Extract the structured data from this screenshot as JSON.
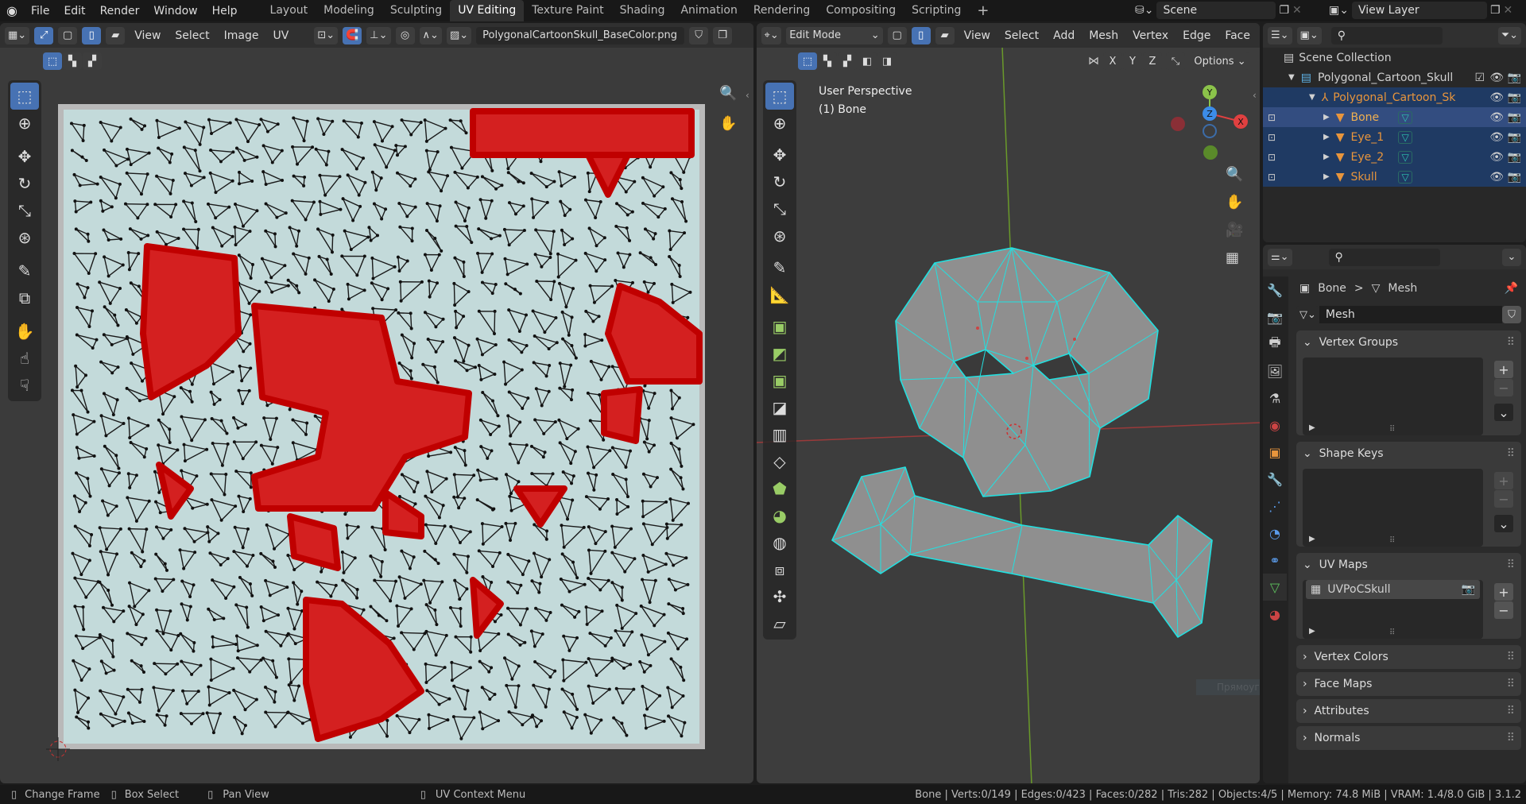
{
  "topbar": {
    "menus": [
      "File",
      "Edit",
      "Render",
      "Window",
      "Help"
    ],
    "workspaces": [
      "Layout",
      "Modeling",
      "Sculpting",
      "UV Editing",
      "Texture Paint",
      "Shading",
      "Animation",
      "Rendering",
      "Compositing",
      "Scripting"
    ],
    "active_workspace": "UV Editing",
    "add_workspace": "+",
    "scene": "Scene",
    "view_layer": "View Layer"
  },
  "uv_editor": {
    "menus": [
      "View",
      "Select",
      "Image",
      "UV"
    ],
    "image_name": "PolygonalCartoonSkull_BaseColor.png",
    "texture_bg": "#c3dada",
    "selected_color": "#d42020"
  },
  "viewport": {
    "mode": "Edit Mode",
    "menus": [
      "View",
      "Select",
      "Add",
      "Mesh",
      "Vertex",
      "Edge",
      "Face"
    ],
    "axes": [
      "X",
      "Y",
      "Z"
    ],
    "options": "Options",
    "overlay_title": "User Perspective",
    "overlay_object": "(1) Bone",
    "gizmo": {
      "x": "X",
      "y": "Y",
      "z": "Z"
    },
    "wire_color": "#22e0e0",
    "tooltip": "Прямоугольник"
  },
  "outliner": {
    "scene_collection": "Scene Collection",
    "collection": "Polygonal_Cartoon_Skull",
    "armature": "Polygonal_Cartoon_Sk",
    "objects": [
      {
        "name": "Bone",
        "active": true
      },
      {
        "name": "Eye_1",
        "active": false
      },
      {
        "name": "Eye_2",
        "active": false
      },
      {
        "name": "Skull",
        "active": false
      }
    ]
  },
  "properties": {
    "breadcrumb_object": "Bone",
    "breadcrumb_sep": ">",
    "breadcrumb_data": "Mesh",
    "mesh_name": "Mesh",
    "panels": {
      "vertex_groups": "Vertex Groups",
      "shape_keys": "Shape Keys",
      "uv_maps": "UV Maps",
      "vertex_colors": "Vertex Colors",
      "face_maps": "Face Maps",
      "attributes": "Attributes",
      "normals": "Normals"
    },
    "uv_map_item": "UVPoCSkull"
  },
  "statusbar": {
    "hints": [
      "Change Frame",
      "Box Select",
      "Pan View",
      "UV Context Menu"
    ],
    "stats": "Bone | Verts:0/149 | Edges:0/423 | Faces:0/282 | Tris:282 | Objects:4/5 | Memory: 74.8 MiB | VRAM: 1.4/8.0 GiB | 3.1.2"
  }
}
